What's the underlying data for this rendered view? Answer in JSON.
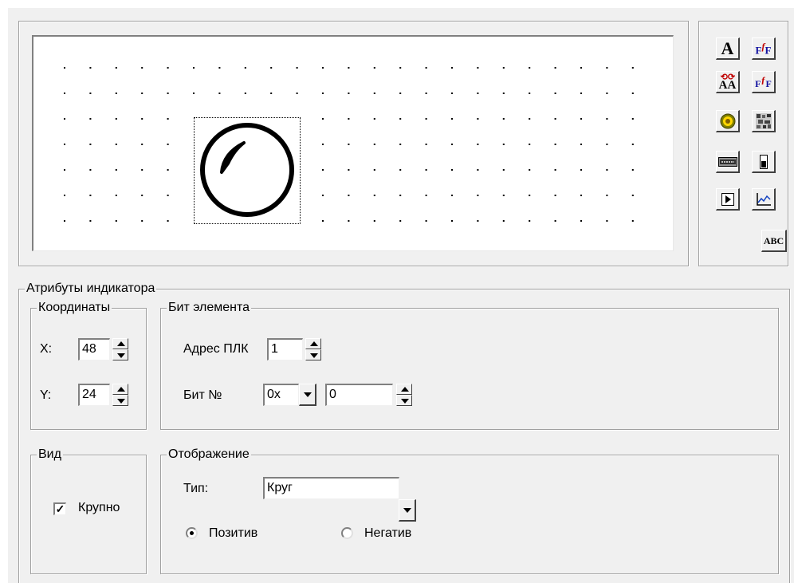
{
  "toolbar": {
    "buttons": [
      {
        "icon": "text-a-icon",
        "glyph": "A"
      },
      {
        "icon": "text-format-icon",
        "glyph": "F"
      },
      {
        "icon": "text-swap-icon",
        "glyph": "AA"
      },
      {
        "icon": "format-swap-icon",
        "glyph": "F"
      },
      {
        "icon": "indicator-lamp-icon",
        "glyph": ""
      },
      {
        "icon": "bitmap-icon",
        "glyph": ""
      },
      {
        "icon": "bargraph-icon",
        "glyph": ""
      },
      {
        "icon": "level-icon",
        "glyph": ""
      },
      {
        "icon": "play-button-icon",
        "glyph": ""
      },
      {
        "icon": "trend-chart-icon",
        "glyph": ""
      },
      {
        "icon": "abc-text-icon",
        "glyph": "ABC"
      }
    ]
  },
  "attributes": {
    "title": "Атрибуты индикатора",
    "coords": {
      "title": "Координаты",
      "x_label": "X:",
      "x_value": "48",
      "y_label": "Y:",
      "y_value": "24"
    },
    "element_bit": {
      "title": "Бит элемента",
      "plc_address_label": "Адрес ПЛК",
      "plc_address_value": "1",
      "bit_label": "Бит №",
      "bit_prefix_value": "0x",
      "bit_value": "0"
    },
    "view": {
      "title": "Вид",
      "large_label": "Крупно",
      "large_checked": true
    },
    "display": {
      "title": "Отображение",
      "type_label": "Тип:",
      "type_value": "Круг",
      "positive_label": "Позитив",
      "negative_label": "Негатив",
      "selected": "positive"
    }
  }
}
